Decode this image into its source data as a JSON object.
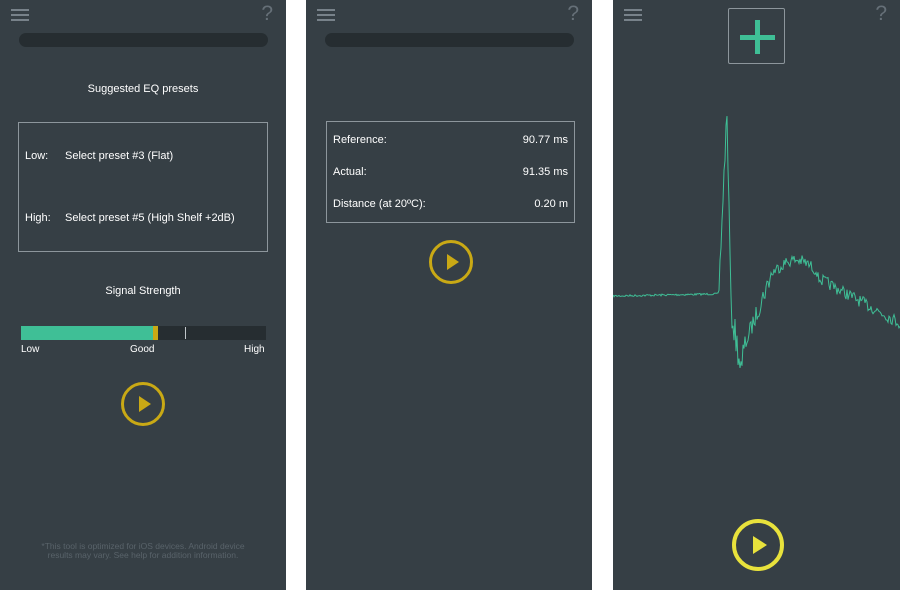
{
  "colors": {
    "background": "#363f45",
    "accent_green": "#3fbf96",
    "accent_yellow": "#c9a915",
    "play_yellow_bright": "#e8e23c"
  },
  "screen1": {
    "eq_title": "Suggested EQ presets",
    "presets": [
      {
        "label": "Low:",
        "value": "Select preset #3 (Flat)"
      },
      {
        "label": "High:",
        "value": "Select preset #5 (High Shelf +2dB)"
      }
    ],
    "signal_title": "Signal Strength",
    "signal_level": 0.56,
    "scale": {
      "low": "Low",
      "good": "Good",
      "high": "High"
    },
    "footnote": "*This tool is optimized for iOS devices. Android device results may vary. See help for addition information.",
    "help": "?"
  },
  "screen2": {
    "rows": [
      {
        "label": "Reference:",
        "value": "90.77 ms"
      },
      {
        "label": "Actual:",
        "value": "91.35 ms"
      },
      {
        "label": "Distance (at 20ºC):",
        "value": "0.20 m"
      }
    ],
    "help": "?"
  },
  "screen3": {
    "help": "?",
    "icons": {
      "add": "plus-icon",
      "play": "play-icon"
    }
  }
}
